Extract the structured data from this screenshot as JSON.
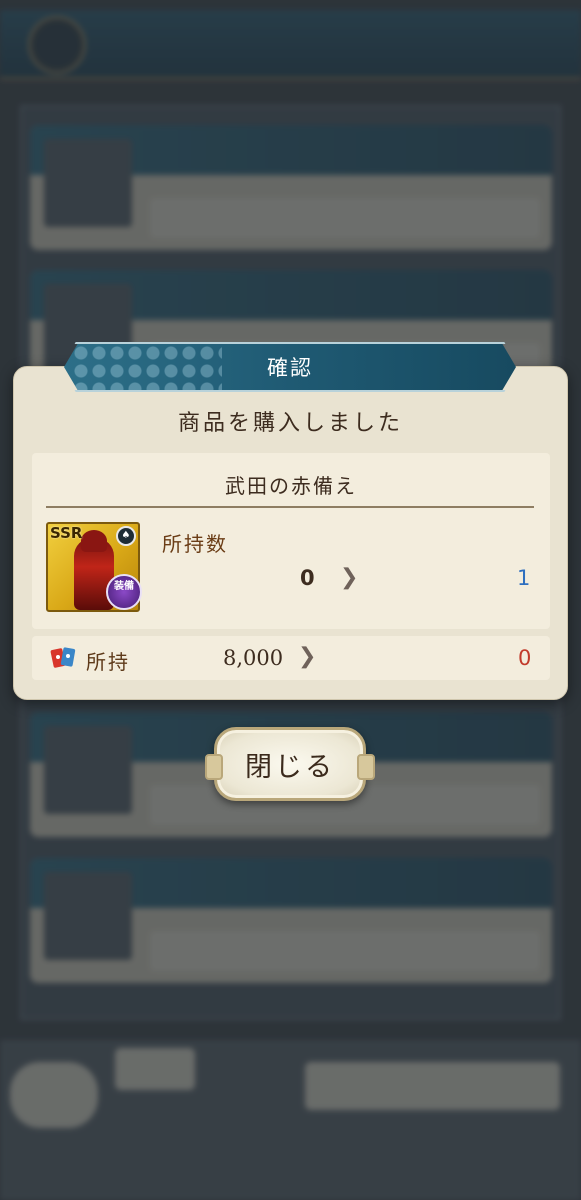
{
  "dialog": {
    "title": "確認",
    "message": "商品を購入しました",
    "item": {
      "name": "武田の赤備え",
      "rarity": "SSR",
      "category_badge": "装備",
      "owned_label": "所持数",
      "owned_before": "0",
      "owned_after": "1"
    },
    "currency": {
      "label": "所持",
      "before": "8,000",
      "after": "0",
      "icon": "ticket-icon"
    },
    "close_label": "閉じる"
  },
  "colors": {
    "banner": "#1f5a73",
    "dialog_bg": "#e9e3d1",
    "owned_after": "#2e6fbf",
    "currency_after": "#c23a2a"
  }
}
